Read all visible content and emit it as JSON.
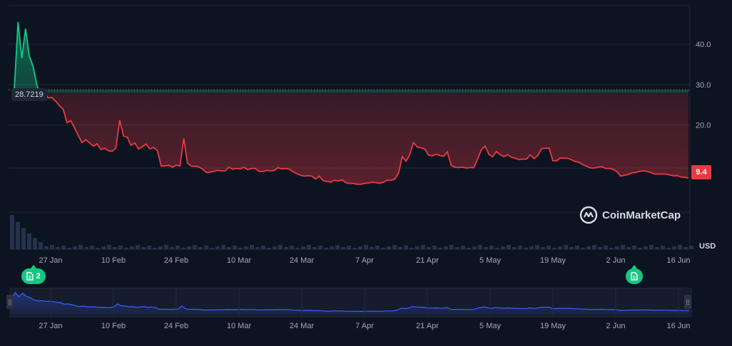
{
  "chart_data": {
    "type": "line",
    "currency": "USD",
    "y_ticks": [
      "40.0",
      "30.0",
      "20.0",
      "9.4"
    ],
    "ylim": [
      -1.5,
      49.5
    ],
    "reference_value": 28.7219,
    "reference_label": "28.7219",
    "last_value_label": "9.4",
    "x_tick_labels": [
      "27 Jan",
      "10 Feb",
      "24 Feb",
      "10 Mar",
      "24 Mar",
      "7 Apr",
      "21 Apr",
      "5 May",
      "19 May",
      "2 Jun",
      "16 Jun"
    ],
    "series": [
      {
        "values": [
          28.7,
          45.5,
          36.5,
          43.8,
          37.0,
          34.5,
          29.8,
          27.6,
          27.9,
          26.7,
          26.8,
          25.9,
          24.8,
          23.9,
          20.6,
          21.1,
          19.3,
          17.4,
          15.7,
          16.4,
          15.6,
          14.8,
          15.4,
          14.0,
          14.3,
          13.7,
          13.5,
          14.4,
          21.2,
          17.3,
          17.0,
          15.0,
          15.6,
          14.1,
          14.7,
          15.3,
          14.1,
          14.5,
          13.7,
          9.9,
          9.9,
          10.1,
          9.6,
          10.1,
          9.9,
          16.7,
          10.6,
          9.9,
          9.8,
          9.7,
          9.1,
          8.3,
          8.4,
          8.6,
          8.8,
          8.7,
          8.7,
          9.6,
          9.1,
          9.3,
          9.2,
          9.6,
          9.0,
          9.3,
          9.3,
          8.6,
          8.5,
          8.8,
          8.7,
          8.8,
          9.5,
          9.2,
          9.3,
          9.1,
          8.5,
          8.0,
          7.6,
          7.4,
          7.5,
          7.4,
          6.7,
          7.4,
          6.3,
          6.1,
          5.9,
          6.4,
          6.2,
          6.5,
          5.8,
          5.6,
          5.6,
          5.4,
          5.4,
          5.6,
          5.7,
          5.9,
          5.8,
          5.6,
          5.9,
          6.4,
          6.4,
          6.6,
          8.1,
          12.2,
          11.1,
          12.7,
          15.7,
          14.6,
          14.4,
          14.1,
          12.6,
          12.4,
          12.8,
          12.5,
          12.3,
          13.4,
          10.0,
          9.6,
          9.5,
          9.6,
          9.4,
          9.5,
          9.5,
          11.6,
          13.9,
          14.8,
          12.8,
          12.2,
          13.5,
          12.7,
          12.2,
          12.7,
          12.1,
          11.8,
          11.5,
          11.6,
          11.6,
          12.7,
          11.7,
          12.5,
          14.2,
          14.3,
          14.3,
          11.2,
          11.2,
          11.9,
          11.8,
          11.8,
          11.4,
          11.0,
          10.8,
          10.2,
          9.8,
          9.4,
          9.4,
          9.6,
          9.7,
          9.3,
          9.3,
          9.1,
          8.5,
          7.4,
          7.6,
          7.8,
          8.2,
          8.3,
          8.6,
          8.7,
          8.6,
          8.3,
          7.9,
          7.9,
          7.9,
          7.9,
          7.7,
          7.5,
          7.5,
          7.2,
          7.1,
          6.9
        ]
      }
    ]
  },
  "brand": {
    "name": "CoinMarketCap"
  },
  "events": [
    {
      "label": "2",
      "icon": "document-icon"
    },
    {
      "label": "",
      "icon": "document-icon"
    }
  ],
  "colors": {
    "up": "#16c784",
    "down": "#ea3943",
    "background": "#0d1421",
    "grid": "#222a38",
    "volume": "#2b3752",
    "navigator_line": "#3861fb"
  }
}
